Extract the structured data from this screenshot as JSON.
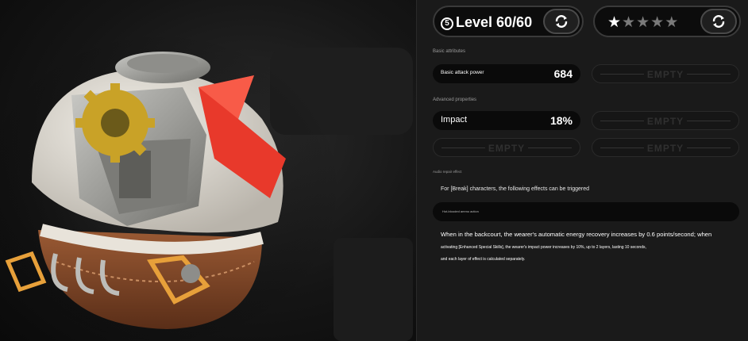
{
  "header": {
    "level_badge": "5",
    "level_text": "Level 60/60",
    "stars": {
      "filled": 1,
      "total": 5
    }
  },
  "basic": {
    "label": "Basic attributes",
    "main_stat": {
      "name": "Basic attack power",
      "value": "684"
    },
    "empty_text": "EMPTY"
  },
  "advanced": {
    "label": "Advanced properties",
    "stat": {
      "name": "Impact",
      "value": "18%"
    },
    "empty_text": "EMPTY"
  },
  "effect": {
    "label": "Audio repair effect",
    "trigger_text": "For [Break] characters, the following effects can be triggered",
    "effect_name": "Hot-blooded ammo action",
    "description_line1": "When in the backcourt, the wearer's automatic energy recovery increases by 0.6 points/second; when",
    "description_line2": "activating [Enhanced Special Skills], the wearer's impact power increases by 10%, up to 2 layers, lasting 10 seconds,",
    "description_line3": "and each layer of effect is calculated separately."
  },
  "colors": {
    "accent_red": "#e8392b",
    "gold": "#c9a227",
    "panel_bg": "#1a1a1a"
  },
  "icons": [
    "refresh-icon",
    "star-icon",
    "numbered-circle-icon"
  ]
}
